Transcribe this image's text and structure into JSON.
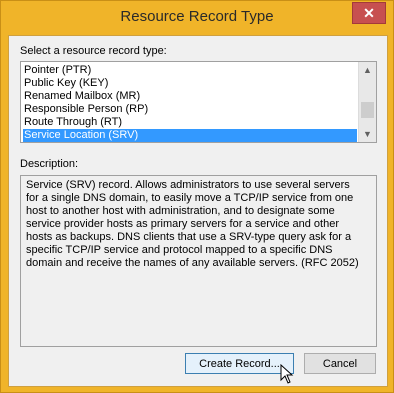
{
  "window": {
    "title": "Resource Record Type",
    "close_glyph": "✕"
  },
  "record_type": {
    "label": "Select a resource record type:",
    "partial_top_item": "",
    "items": [
      {
        "label": "Pointer (PTR)",
        "selected": false
      },
      {
        "label": "Public Key (KEY)",
        "selected": false
      },
      {
        "label": "Renamed Mailbox (MR)",
        "selected": false
      },
      {
        "label": "Responsible Person (RP)",
        "selected": false
      },
      {
        "label": "Route Through (RT)",
        "selected": false
      },
      {
        "label": "Service Location (SRV)",
        "selected": true
      }
    ]
  },
  "description": {
    "label": "Description:",
    "text": "Service (SRV) record. Allows administrators to use several servers\nfor a single DNS domain, to easily move a TCP/IP service from one\nhost to another host with administration, and to designate some\nservice provider hosts as primary servers for a service and other\nhosts as backups. DNS clients that use a SRV-type query ask for a\nspecific TCP/IP service and protocol mapped to a specific DNS\ndomain and receive the names of any available servers. (RFC 2052)"
  },
  "buttons": {
    "create_label": "Create Record...",
    "cancel_label": "Cancel"
  },
  "icons": {
    "close": "close-icon",
    "scroll_up": "scroll-up-icon",
    "scroll_down": "scroll-down-icon",
    "cursor": "mouse-pointer-icon"
  },
  "colors": {
    "window_border": "#f0b429",
    "close_button": "#c75050",
    "selection": "#3399ff",
    "default_button": "#e5f1fb"
  }
}
